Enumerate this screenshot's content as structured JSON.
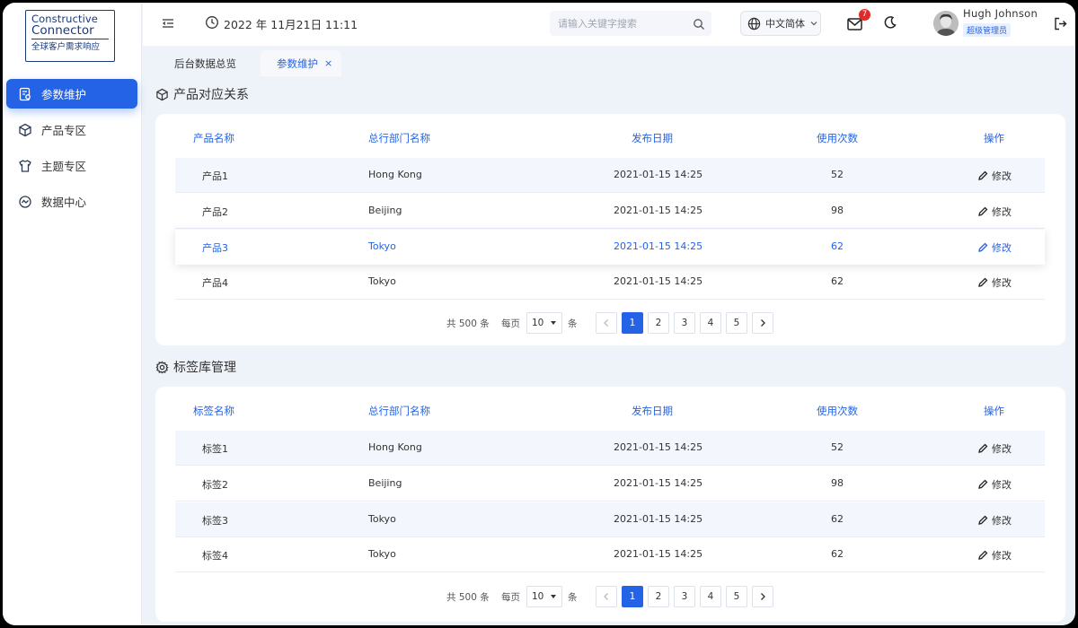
{
  "logo": {
    "line1": "Constructive",
    "line2": "Connector",
    "line3": "全球客户需求响应"
  },
  "sidebar": {
    "items": [
      {
        "label": "参数维护",
        "icon": "settings-doc-icon",
        "active": true
      },
      {
        "label": "产品专区",
        "icon": "box-icon",
        "active": false
      },
      {
        "label": "主题专区",
        "icon": "shirt-icon",
        "active": false
      },
      {
        "label": "数据中心",
        "icon": "chart-circle-icon",
        "active": false
      }
    ]
  },
  "header": {
    "date": "2022 年 11月21日 11:11",
    "search_placeholder": "请输入关键字搜索",
    "language": "中文简体",
    "mail_badge": "7",
    "user_name": "Hugh  Johnson",
    "user_role": "超级管理员"
  },
  "tabs": [
    {
      "label": "后台数据总览",
      "active": false
    },
    {
      "label": "参数维护",
      "active": true,
      "close": "×"
    }
  ],
  "sections": [
    {
      "title": "产品对应关系",
      "icon": "cube-icon",
      "columns": [
        "产品名称",
        "总行部门名称",
        "发布日期",
        "使用次数",
        "操作"
      ],
      "rows": [
        {
          "name": "产品1",
          "dept": "Hong Kong",
          "date": "2021-01-15 14:25",
          "count": "52",
          "action": "修改"
        },
        {
          "name": "产品2",
          "dept": "Beijing",
          "date": "2021-01-15 14:25",
          "count": "98",
          "action": "修改"
        },
        {
          "name": "产品3",
          "dept": "Tokyo",
          "date": "2021-01-15 14:25",
          "count": "62",
          "action": "修改"
        },
        {
          "name": "产品4",
          "dept": "Tokyo",
          "date": "2021-01-15 14:25",
          "count": "62",
          "action": "修改"
        }
      ],
      "pagination": {
        "total": "共 500 条",
        "per_page_label": "每页",
        "per_page": "10",
        "unit": "条",
        "pages": [
          "1",
          "2",
          "3",
          "4",
          "5"
        ],
        "current": "1"
      }
    },
    {
      "title": "标签库管理",
      "icon": "gear-icon",
      "columns": [
        "标签名称",
        "总行部门名称",
        "发布日期",
        "使用次数",
        "操作"
      ],
      "rows": [
        {
          "name": "标签1",
          "dept": "Hong Kong",
          "date": "2021-01-15 14:25",
          "count": "52",
          "action": "修改"
        },
        {
          "name": "标签2",
          "dept": "Beijing",
          "date": "2021-01-15 14:25",
          "count": "98",
          "action": "修改"
        },
        {
          "name": "标签3",
          "dept": "Tokyo",
          "date": "2021-01-15 14:25",
          "count": "62",
          "action": "修改"
        },
        {
          "name": "标签4",
          "dept": "Tokyo",
          "date": "2021-01-15 14:25",
          "count": "62",
          "action": "修改"
        }
      ],
      "pagination": {
        "total": "共 500 条",
        "per_page_label": "每页",
        "per_page": "10",
        "unit": "条",
        "pages": [
          "1",
          "2",
          "3",
          "4",
          "5"
        ],
        "current": "1"
      }
    }
  ],
  "colors": {
    "accent": "#2563e6",
    "badge": "#e02b2b",
    "background": "#eef2f9"
  }
}
